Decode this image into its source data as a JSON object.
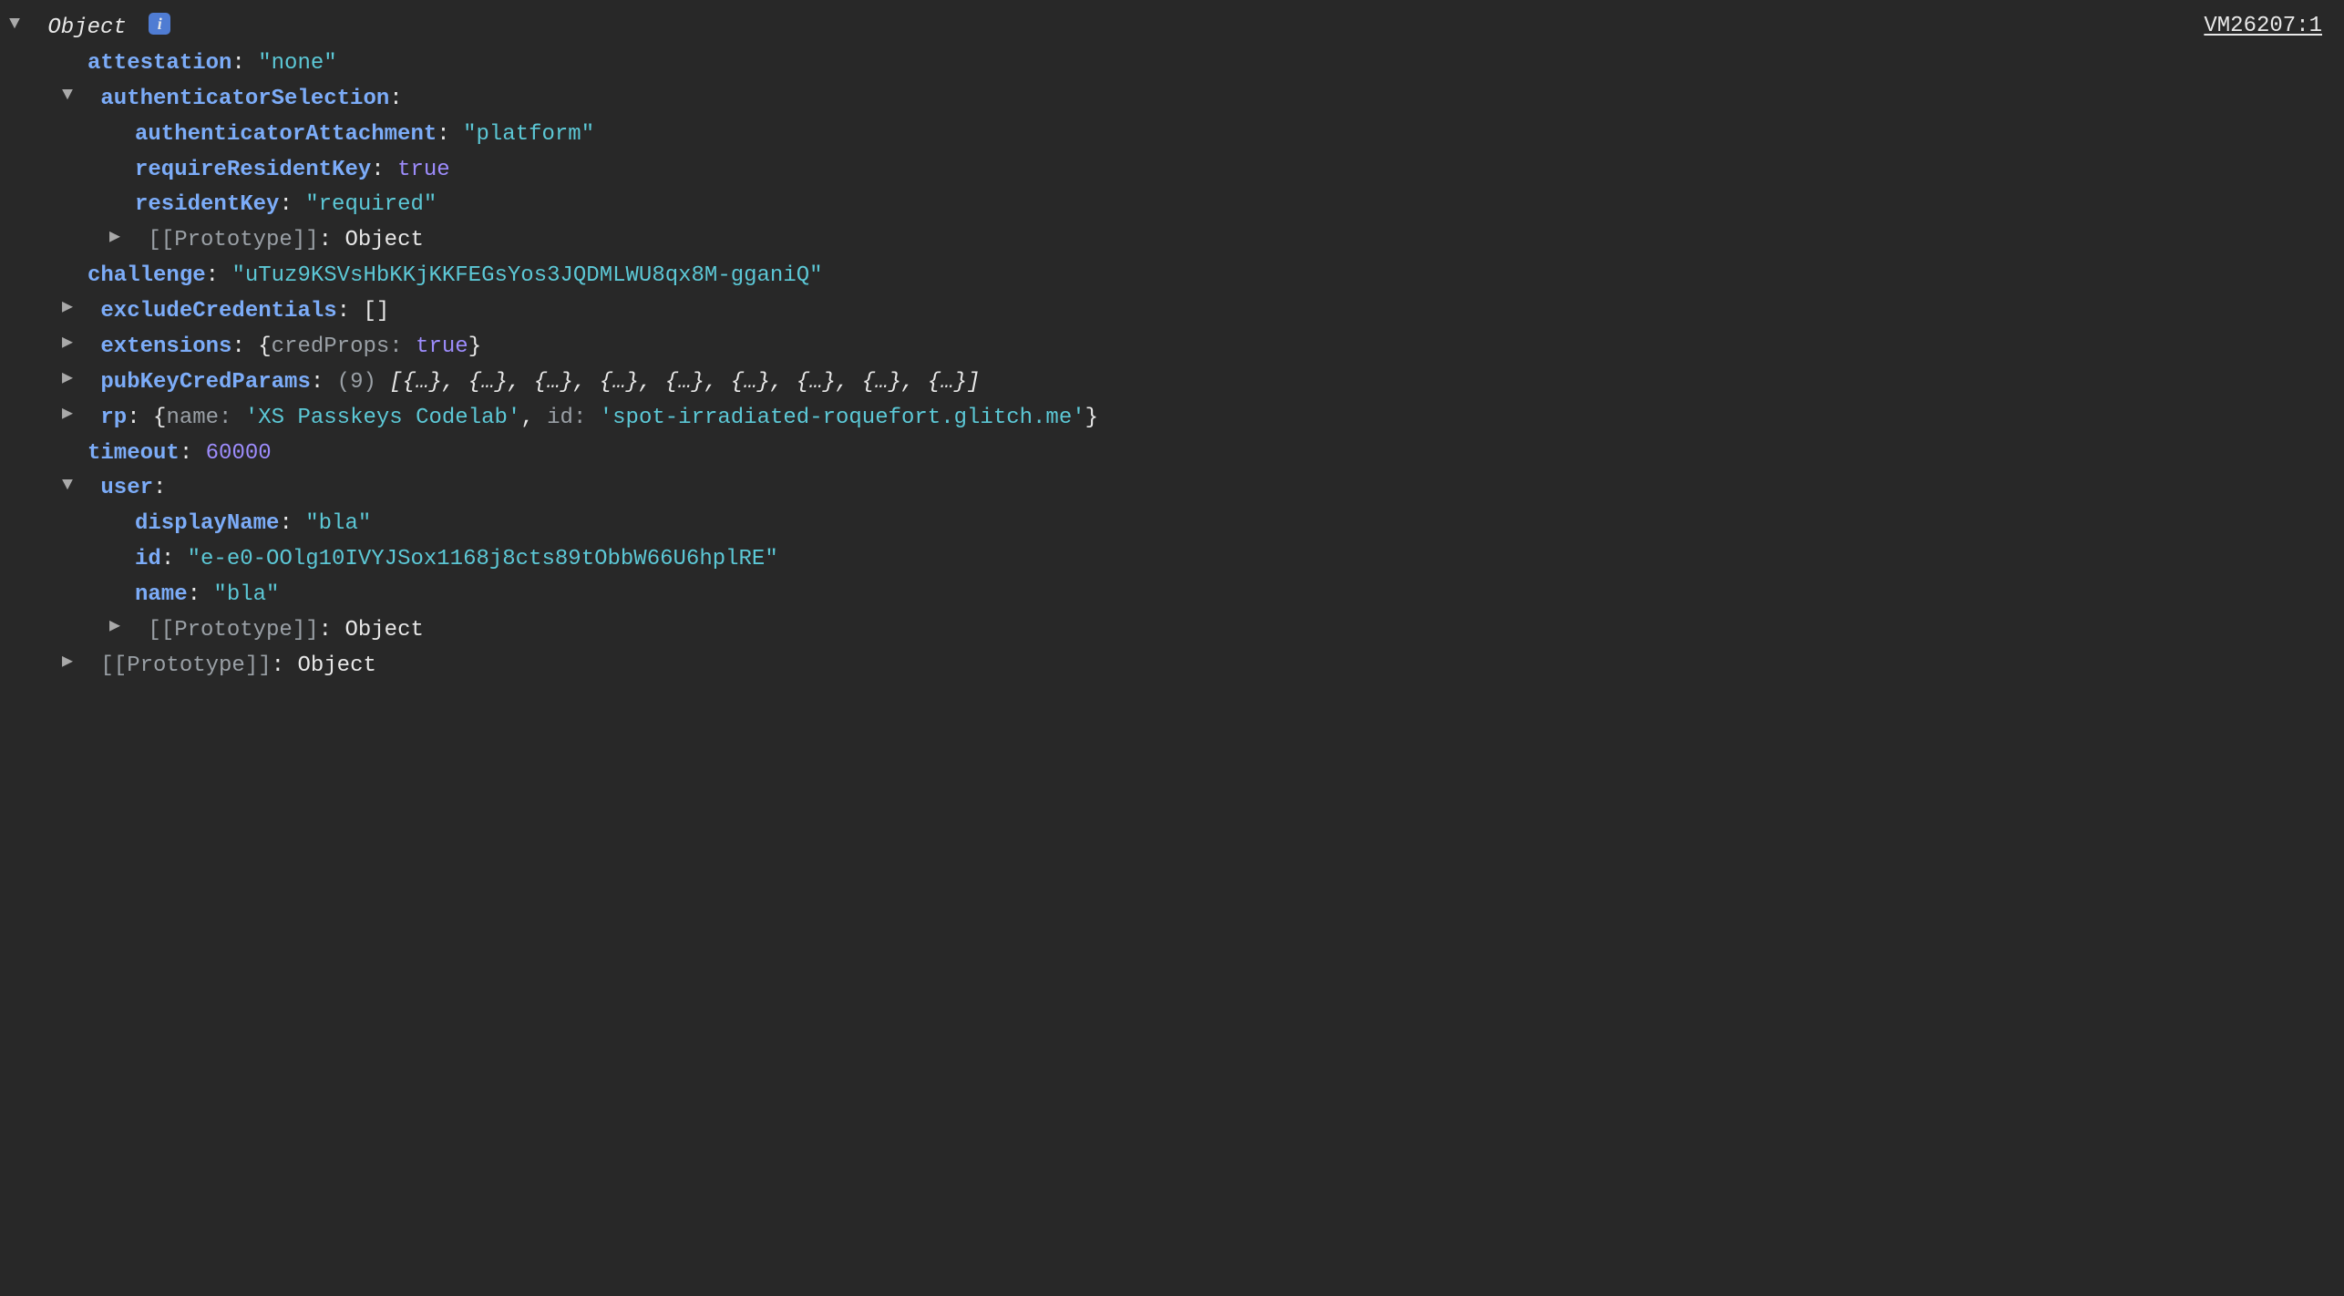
{
  "source_link": "VM26207:1",
  "arrows": {
    "down": "▼",
    "right": "▶"
  },
  "root_label": "Object",
  "info_badge": "i",
  "colon": ":",
  "lines": {
    "attestation": {
      "key": "attestation",
      "value": "\"none\""
    },
    "authSel": {
      "key": "authenticatorSelection"
    },
    "authAttach": {
      "key": "authenticatorAttachment",
      "value": "\"platform\""
    },
    "requireResidentKey": {
      "key": "requireResidentKey",
      "value": "true"
    },
    "residentKey": {
      "key": "residentKey",
      "value": "\"required\""
    },
    "proto1": {
      "key": "[[Prototype]]",
      "value": "Object"
    },
    "challenge": {
      "key": "challenge",
      "value": "\"uTuz9KSVsHbKKjKKFEGsYos3JQDMLWU8qx8M-gganiQ\""
    },
    "excludeCredentials": {
      "key": "excludeCredentials",
      "value": "[]"
    },
    "extensions": {
      "key": "extensions",
      "open": "{",
      "inner_key": "credProps",
      "inner_colon": ": ",
      "inner_val": "true",
      "close": "}"
    },
    "pubKeyCredParams": {
      "key": "pubKeyCredParams",
      "count_open": "(",
      "count": "9",
      "count_close": ") ",
      "body": "[{…}, {…}, {…}, {…}, {…}, {…}, {…}, {…}, {…}]"
    },
    "rp": {
      "key": "rp",
      "open": "{",
      "k1": "name",
      "c": ": ",
      "v1": "'XS Passkeys Codelab'",
      "sep": ", ",
      "k2": "id",
      "v2": "'spot-irradiated-roquefort.glitch.me'",
      "close": "}"
    },
    "timeout": {
      "key": "timeout",
      "value": "60000"
    },
    "user": {
      "key": "user"
    },
    "displayName": {
      "key": "displayName",
      "value": "\"bla\""
    },
    "userId": {
      "key": "id",
      "value": "\"e-e0-OOlg10IVYJSox1168j8cts89tObbW66U6hplRE\""
    },
    "userName": {
      "key": "name",
      "value": "\"bla\""
    },
    "proto2": {
      "key": "[[Prototype]]",
      "value": "Object"
    },
    "proto3": {
      "key": "[[Prototype]]",
      "value": "Object"
    }
  }
}
